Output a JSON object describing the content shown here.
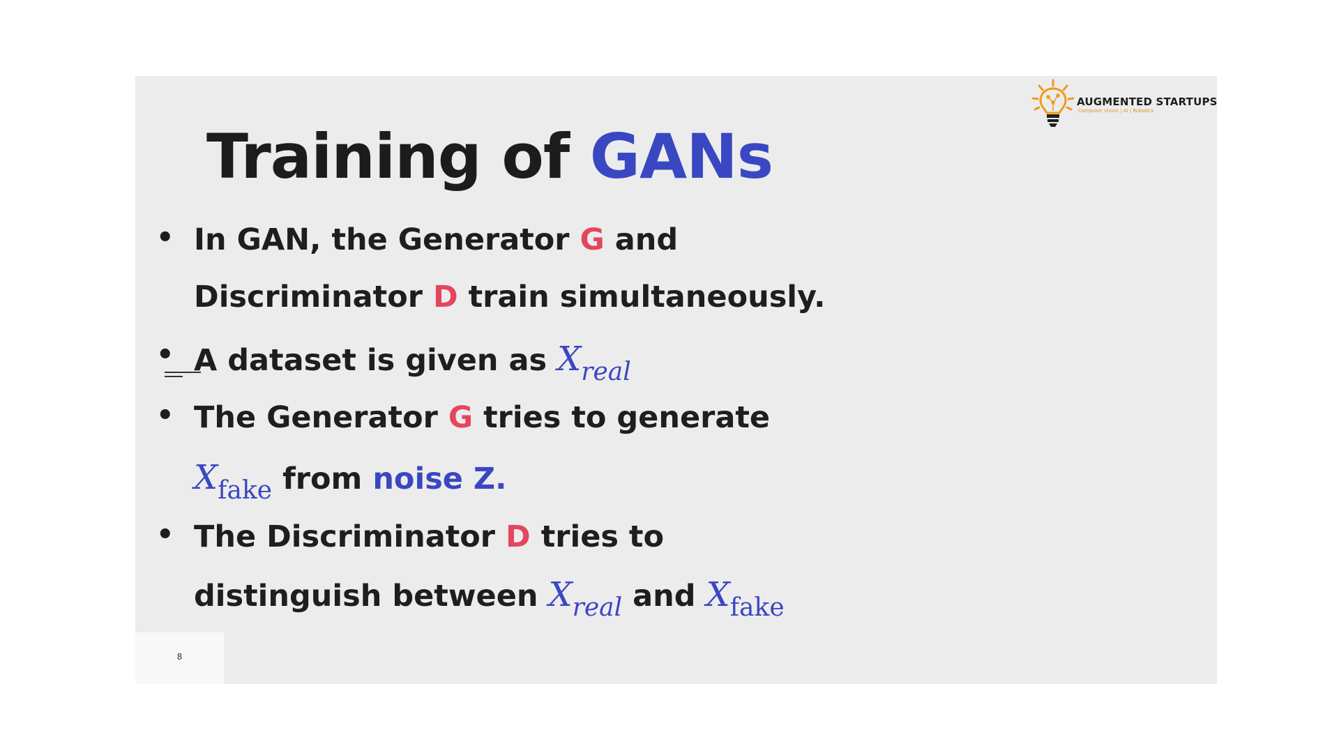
{
  "slide": {
    "title_main": "Training of",
    "title_accent": "GANs",
    "logo": {
      "name": "AUGMENTED STARTUPS",
      "tagline": "Computer Vision | AI | Robotics"
    },
    "page_number": "8",
    "bullets": [
      {
        "line1": {
          "a": "In GAN, the Generator",
          "g": "G",
          "b": "and"
        },
        "line2": {
          "a": "Discriminator",
          "d": "D",
          "b": "train simultaneously."
        }
      },
      {
        "text": "A dataset is given as",
        "var": "X",
        "sub": "real"
      },
      {
        "line1": {
          "a": "The Generator",
          "g": "G",
          "b": "tries to generate"
        },
        "line2": {
          "var": "X",
          "sub": "fake",
          "a": "from",
          "noise": "noise Z."
        }
      },
      {
        "line1": {
          "a": "The Discriminator",
          "d": "D",
          "b": "tries to"
        },
        "line2": {
          "a": "distinguish between",
          "var1": "X",
          "sub1": "real",
          "and": "and",
          "var2": "X",
          "sub2": "fake"
        }
      }
    ]
  }
}
